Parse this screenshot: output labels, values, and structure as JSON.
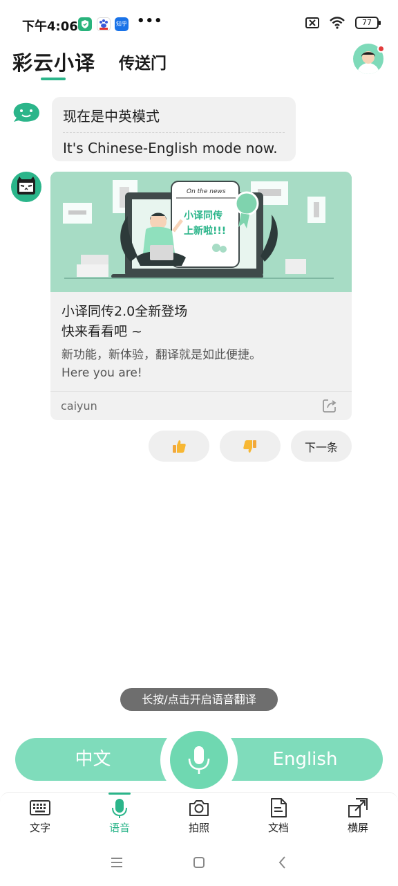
{
  "status_bar": {
    "time": "下午4:06",
    "apps": [
      {
        "name": "shield-app",
        "label": "",
        "color": "#29b37c"
      },
      {
        "name": "baidu-app",
        "label": "",
        "color": "#3b5bdb"
      },
      {
        "name": "zhihu-app",
        "label": "知乎",
        "color": "#1a73e8"
      }
    ],
    "more": "•••",
    "battery": "77"
  },
  "header": {
    "title_tab": "彩云小译",
    "second_tab": "传送门"
  },
  "mode_message": {
    "zh": "现在是中英模式",
    "en": "It's Chinese-English mode now."
  },
  "news_card": {
    "banner": {
      "paper_header": "On the news",
      "headline_line1": "小译同传",
      "headline_line2": "上新啦!!!"
    },
    "title_line1": "小译同传2.0全新登场",
    "title_line2": "快来看看吧 ~",
    "desc_line1": "新功能，新体验，翻译就是如此便捷。",
    "desc_line2": "Here you are!",
    "source": "caiyun"
  },
  "feedback": {
    "like_icon": "thumbs-up-icon",
    "dislike_icon": "thumbs-down-icon",
    "next_label": "下一条"
  },
  "voice_hint": "长按/点击开启语音翻译",
  "language_bar": {
    "left": "中文",
    "right": "English"
  },
  "bottom_nav": [
    {
      "label": "文字",
      "icon": "keyboard-icon",
      "active": false
    },
    {
      "label": "语音",
      "icon": "microphone-icon",
      "active": true
    },
    {
      "label": "拍照",
      "icon": "camera-icon",
      "active": false
    },
    {
      "label": "文档",
      "icon": "document-icon",
      "active": false
    },
    {
      "label": "横屏",
      "icon": "landscape-icon",
      "active": false
    }
  ],
  "colors": {
    "accent": "#2bb58a",
    "language_bar": "#7fdcbb",
    "banner": "#a7dcc5"
  }
}
